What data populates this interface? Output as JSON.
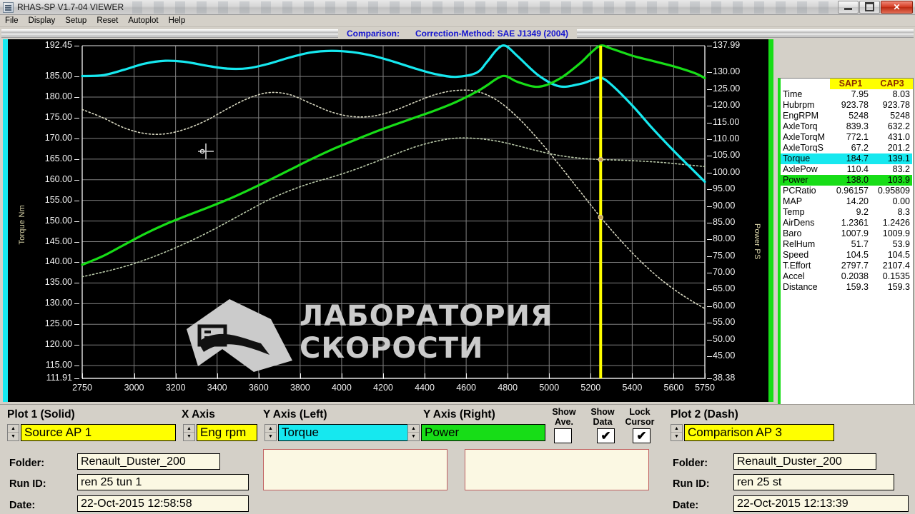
{
  "window": {
    "title": "RHAS-SP V1.7-04  VIEWER",
    "icon": "app-icon",
    "buttons": {
      "minimize": "minimize",
      "maximize": "restore",
      "close": "✕"
    }
  },
  "menu": {
    "items": [
      "File",
      "Display",
      "Setup",
      "Reset",
      "Autoplot",
      "Help"
    ]
  },
  "header": {
    "comparison_label": "Comparison:",
    "correction_method": "Correction-Method: SAE J1349 (2004)"
  },
  "watermark": {
    "line1": "Лаборатория",
    "line2": "Скорости"
  },
  "colors": {
    "torque": "#16e8ef",
    "power": "#17dd17",
    "cursor": "#ffff00",
    "plot_bg": "#000000",
    "grid": "#808080",
    "panel_bg": "#d4d0c8",
    "header_text": "#1515cf",
    "highlight_yellow": "#ffff00"
  },
  "chart_data": {
    "type": "line",
    "title": "",
    "xlabel": "",
    "ylabel": "Torque Nm",
    "y2label": "Power PS",
    "xlim": [
      2750,
      5750
    ],
    "ylim": [
      111.91,
      192.45
    ],
    "y2lim": [
      38.38,
      137.99
    ],
    "grid": true,
    "legend_position": "none",
    "xticks": [
      2750,
      3000,
      3200,
      3400,
      3600,
      3800,
      4000,
      4200,
      4400,
      4600,
      4800,
      5000,
      5200,
      5400,
      5600,
      5750
    ],
    "yticks_left": [
      192.45,
      185.0,
      180.0,
      175.0,
      170.0,
      165.0,
      160.0,
      155.0,
      150.0,
      145.0,
      140.0,
      135.0,
      130.0,
      125.0,
      120.0,
      115.0,
      111.91
    ],
    "yticks_right": [
      137.99,
      130.0,
      125.0,
      120.0,
      115.0,
      110.0,
      105.0,
      100.0,
      95.0,
      90.0,
      85.0,
      80.0,
      75.0,
      70.0,
      65.0,
      60.0,
      55.0,
      50.0,
      45.0,
      38.38
    ],
    "cursor_x": 5248,
    "series": [
      {
        "name": "Torque AP 1",
        "axis": "left",
        "style": "solid",
        "color": "#16e8ef",
        "x": [
          2750,
          2850,
          2950,
          3050,
          3150,
          3250,
          3350,
          3450,
          3550,
          3650,
          3750,
          3850,
          3950,
          4050,
          4150,
          4250,
          4350,
          4450,
          4550,
          4650,
          4700,
          4750,
          4790,
          4850,
          4950,
          5050,
          5150,
          5200,
          5248,
          5300,
          5400,
          5500,
          5600,
          5700,
          5750
        ],
        "y": [
          185.1,
          185.3,
          186.6,
          188.1,
          188.8,
          188.5,
          187.6,
          186.9,
          187.0,
          188.1,
          189.6,
          190.8,
          191.2,
          190.9,
          190.0,
          188.6,
          187.0,
          185.6,
          184.9,
          185.9,
          188.5,
          191.6,
          192.4,
          189.8,
          185.2,
          182.6,
          183.2,
          184.0,
          184.7,
          183.0,
          178.0,
          172.3,
          167.0,
          162.0,
          159.5
        ]
      },
      {
        "name": "Power AP 1",
        "axis": "right",
        "style": "solid",
        "color": "#17dd17",
        "x": [
          2750,
          2850,
          2950,
          3050,
          3150,
          3250,
          3350,
          3450,
          3550,
          3650,
          3750,
          3850,
          3950,
          4050,
          4150,
          4250,
          4350,
          4450,
          4550,
          4650,
          4700,
          4750,
          4790,
          4850,
          4950,
          5050,
          5150,
          5200,
          5248,
          5300,
          5400,
          5500,
          5600,
          5700,
          5750
        ],
        "y": [
          72.4,
          75.0,
          78.3,
          81.6,
          84.5,
          87.0,
          89.4,
          91.9,
          94.7,
          97.7,
          100.8,
          103.9,
          106.8,
          109.4,
          111.9,
          114.2,
          116.4,
          118.6,
          121.1,
          124.2,
          126.1,
          128.2,
          128.9,
          127.1,
          125.7,
          128.1,
          132.8,
          135.8,
          138.0,
          137.1,
          135.0,
          133.4,
          131.8,
          129.8,
          128.3
        ]
      },
      {
        "name": "Torque AP 3",
        "axis": "left",
        "style": "dash",
        "color": "#d7d7c0",
        "x": [
          2750,
          2850,
          2950,
          3050,
          3150,
          3250,
          3350,
          3450,
          3550,
          3650,
          3750,
          3850,
          3950,
          4050,
          4150,
          4250,
          4350,
          4450,
          4550,
          4650,
          4750,
          4850,
          4950,
          5050,
          5150,
          5248,
          5350,
          5450,
          5550,
          5650,
          5750
        ],
        "y": [
          177.0,
          175.0,
          172.6,
          171.2,
          171.1,
          172.3,
          174.4,
          177.2,
          179.7,
          181.1,
          180.6,
          178.5,
          176.4,
          175.3,
          175.4,
          176.7,
          178.7,
          180.6,
          181.6,
          181.4,
          179.2,
          175.0,
          169.6,
          163.5,
          157.1,
          150.9,
          145.0,
          139.8,
          135.4,
          131.8,
          128.8
        ]
      },
      {
        "name": "Power AP 3",
        "axis": "right",
        "style": "dash",
        "color": "#b8c8a8",
        "x": [
          2750,
          2850,
          2950,
          3050,
          3150,
          3250,
          3350,
          3450,
          3550,
          3650,
          3750,
          3850,
          3950,
          4050,
          4150,
          4250,
          4350,
          4450,
          4550,
          4650,
          4750,
          4850,
          4950,
          5050,
          5150,
          5248,
          5350,
          5450,
          5550,
          5650,
          5750
        ],
        "y": [
          68.8,
          70.2,
          71.8,
          73.8,
          76.2,
          78.9,
          81.9,
          85.2,
          88.6,
          91.9,
          94.6,
          96.8,
          98.6,
          100.6,
          102.9,
          105.3,
          107.6,
          109.3,
          110.3,
          110.2,
          109.4,
          108.0,
          106.4,
          105.1,
          104.3,
          103.9,
          103.7,
          103.4,
          103.0,
          102.4,
          101.8
        ]
      }
    ]
  },
  "data_panel": {
    "columns": [
      "SAP1",
      "CAP3"
    ],
    "rows": [
      {
        "label": "Time",
        "sap1": "7.95",
        "cap3": "8.03",
        "hl": ""
      },
      {
        "label": "Hubrpm",
        "sap1": "923.78",
        "cap3": "923.78",
        "hl": ""
      },
      {
        "label": "EngRPM",
        "sap1": "5248",
        "cap3": "5248",
        "hl": ""
      },
      {
        "label": "AxleTorq",
        "sap1": "839.3",
        "cap3": "632.2",
        "hl": ""
      },
      {
        "label": "AxleTorqM",
        "sap1": "772.1",
        "cap3": "431.0",
        "hl": ""
      },
      {
        "label": "AxleTorqS",
        "sap1": "67.2",
        "cap3": "201.2",
        "hl": ""
      },
      {
        "label": "Torque",
        "sap1": "184.7",
        "cap3": "139.1",
        "hl": "cyan"
      },
      {
        "label": "AxlePow",
        "sap1": "110.4",
        "cap3": "83.2",
        "hl": ""
      },
      {
        "label": "Power",
        "sap1": "138.0",
        "cap3": "103.9",
        "hl": "green"
      },
      {
        "label": "PCRatio",
        "sap1": "0.96157",
        "cap3": "0.95809",
        "hl": ""
      },
      {
        "label": "MAP",
        "sap1": "14.20",
        "cap3": "0.00",
        "hl": ""
      },
      {
        "label": "Temp",
        "sap1": "9.2",
        "cap3": "8.3",
        "hl": ""
      },
      {
        "label": "AirDens",
        "sap1": "1.2361",
        "cap3": "1.2426",
        "hl": ""
      },
      {
        "label": "Baro",
        "sap1": "1007.9",
        "cap3": "1009.9",
        "hl": ""
      },
      {
        "label": "RelHum",
        "sap1": "51.7",
        "cap3": "53.9",
        "hl": ""
      },
      {
        "label": "Speed",
        "sap1": "104.5",
        "cap3": "104.5",
        "hl": ""
      },
      {
        "label": "T.Effort",
        "sap1": "2797.7",
        "cap3": "2107.4",
        "hl": ""
      },
      {
        "label": "Accel",
        "sap1": "0.2038",
        "cap3": "0.1535",
        "hl": ""
      },
      {
        "label": "Distance",
        "sap1": "159.3",
        "cap3": "159.3",
        "hl": ""
      }
    ]
  },
  "controls": {
    "plot1": {
      "title": "Plot 1 (Solid)",
      "source": "Source AP 1",
      "folder_label": "Folder:",
      "folder": "Renault_Duster_200",
      "runid_label": "Run ID:",
      "runid": "ren  25 tun 1",
      "date_label": "Date:",
      "date": "22-Oct-2015  12:58:58"
    },
    "xaxis": {
      "title": "X Axis",
      "value": "Eng rpm"
    },
    "yaxis_left": {
      "title": "Y Axis (Left)",
      "value": "Torque"
    },
    "yaxis_right": {
      "title": "Y Axis (Right)",
      "value": "Power"
    },
    "checkboxes": [
      {
        "line1": "Show",
        "line2": "Ave.",
        "checked": ""
      },
      {
        "line1": "Show",
        "line2": "Data",
        "checked": "✔"
      },
      {
        "line1": "Lock",
        "line2": "Cursor",
        "checked": "✔"
      }
    ],
    "plot2": {
      "title": "Plot 2 (Dash)",
      "source": "Comparison AP 3",
      "folder_label": "Folder:",
      "folder": "Renault_Duster_200",
      "runid_label": "Run ID:",
      "runid": "ren  25 st",
      "date_label": "Date:",
      "date": "22-Oct-2015  12:13:39"
    }
  }
}
